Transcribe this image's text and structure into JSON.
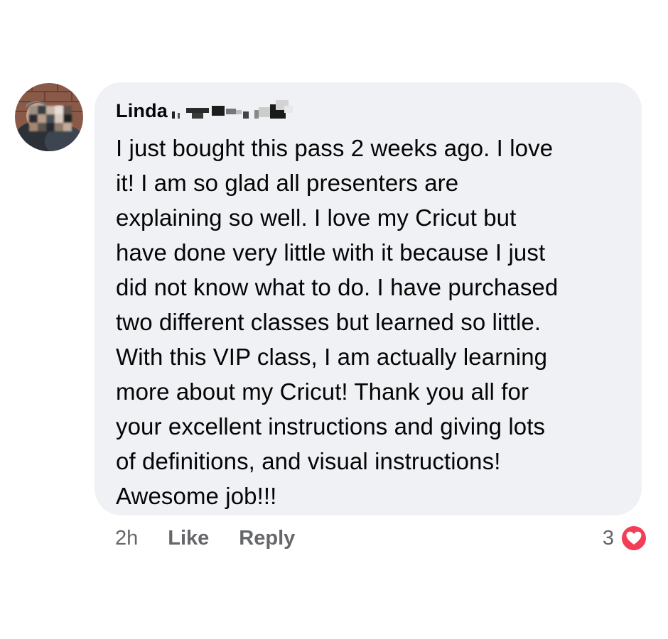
{
  "comment": {
    "author": "Linda",
    "text": "I just bought this pass 2 weeks ago.  I love\nit!  I am so glad all presenters are\nexplaining so well.  I love my Cricut but\nhave done very little with it because I just\ndid not know what to do.  I have purchased\ntwo different classes but learned so little.\nWith this VIP class, I am actually learning\nmore about my Cricut!  Thank you all for\nyour excellent instructions and giving lots\nof definitions, and visual instructions!\nAwesome job!!!",
    "avatar_icon": "avatar-photo-blurred",
    "redaction_icon": "redacted-surname-icon"
  },
  "actions": {
    "timestamp": "2h",
    "like_label": "Like",
    "reply_label": "Reply"
  },
  "reactions": {
    "count": "3",
    "icon": "heart-reaction-icon",
    "color": "#f33e58"
  },
  "colors": {
    "bubble_background": "#f0f1f5",
    "text_primary": "#050505",
    "text_secondary": "#65676b"
  }
}
